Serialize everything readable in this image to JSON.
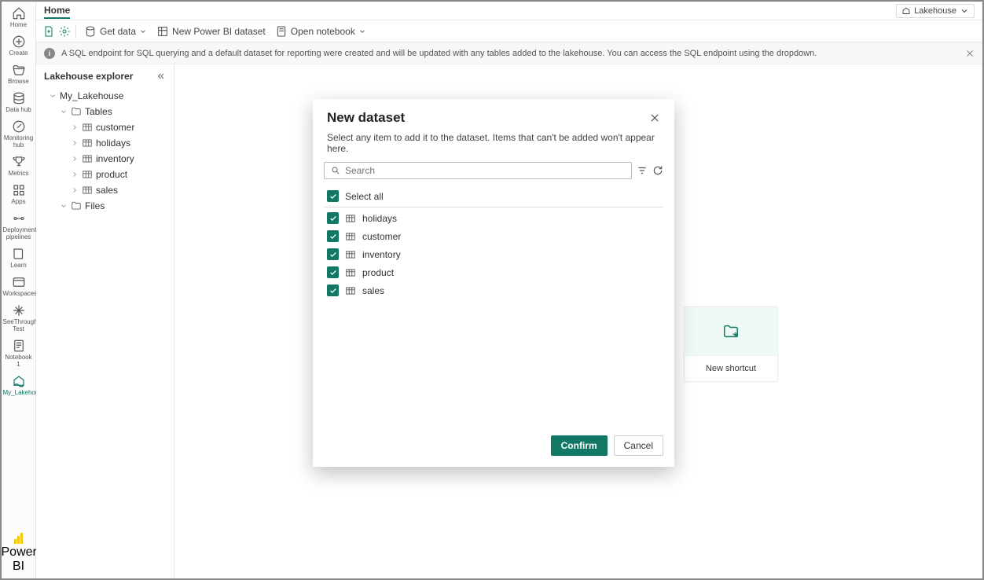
{
  "rail": {
    "items": [
      {
        "label": "Home"
      },
      {
        "label": "Create"
      },
      {
        "label": "Browse"
      },
      {
        "label": "Data hub"
      },
      {
        "label": "Monitoring hub"
      },
      {
        "label": "Metrics"
      },
      {
        "label": "Apps"
      },
      {
        "label": "Deployment pipelines"
      },
      {
        "label": "Learn"
      },
      {
        "label": "Workspaces"
      },
      {
        "label": "SeeThrough Test"
      },
      {
        "label": "Notebook 1"
      },
      {
        "label": "My_Lakehouse"
      }
    ],
    "bottom_label": "Power BI"
  },
  "header": {
    "tab": "Home",
    "workspace_switcher": "Lakehouse"
  },
  "toolbar": {
    "get_data": "Get data",
    "new_pbi_dataset": "New Power BI dataset",
    "open_notebook": "Open notebook"
  },
  "banner": {
    "text": "A SQL endpoint for SQL querying and a default dataset for reporting were created and will be updated with any tables added to the lakehouse. You can access the SQL endpoint using the dropdown."
  },
  "explorer": {
    "title": "Lakehouse explorer",
    "root": "My_Lakehouse",
    "tables_label": "Tables",
    "tables": [
      "customer",
      "holidays",
      "inventory",
      "product",
      "sales"
    ],
    "files_label": "Files"
  },
  "card": {
    "label": "New shortcut"
  },
  "modal": {
    "title": "New dataset",
    "subtitle": "Select any item to add it to the dataset. Items that can't be added won't appear here.",
    "search_placeholder": "Search",
    "select_all": "Select all",
    "items": [
      "holidays",
      "customer",
      "inventory",
      "product",
      "sales"
    ],
    "confirm": "Confirm",
    "cancel": "Cancel"
  }
}
